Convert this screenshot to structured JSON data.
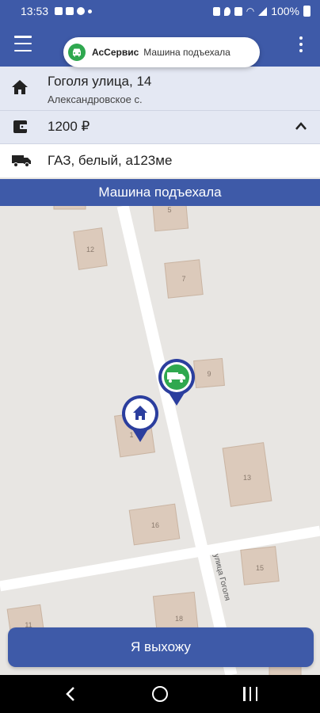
{
  "status_bar": {
    "time": "13:53",
    "battery": "100%"
  },
  "notification": {
    "app": "АсСервис",
    "text": "Машина подъехала"
  },
  "order": {
    "address": "Гоголя улица, 14",
    "locality": "Александровское с.",
    "price": "1200 ₽",
    "car": "ГАЗ, белый, а123ме"
  },
  "banner": "Машина подъехала",
  "map": {
    "street_label": "улица Гоголя",
    "house_numbers": [
      "5",
      "12",
      "7",
      "9",
      "1",
      "13",
      "16",
      "15",
      "18",
      "11"
    ]
  },
  "action_button": "Я выхожу",
  "colors": {
    "primary": "#3e5aa8",
    "accent_green": "#2fa84f",
    "marker_blue": "#2b3e9e"
  },
  "icons": [
    "menu-icon",
    "more-vert-icon",
    "home-icon",
    "wallet-icon",
    "truck-icon",
    "chevron-up-icon"
  ]
}
